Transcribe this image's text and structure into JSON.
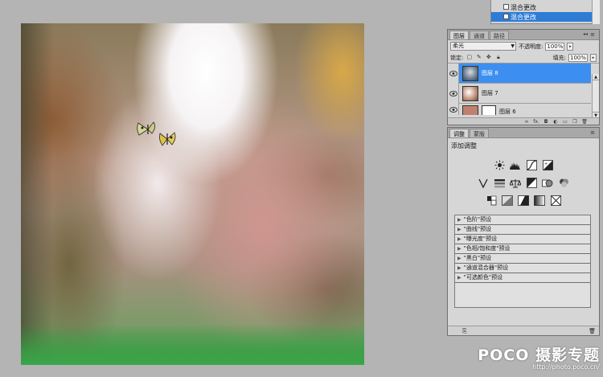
{
  "top_layers": {
    "rows": [
      {
        "label": "混合更改",
        "selected": false
      },
      {
        "label": "混合更改",
        "selected": true
      }
    ]
  },
  "layers_panel": {
    "tabs": [
      "图层",
      "通道",
      "路径"
    ],
    "blend_mode": "柔光",
    "opacity_label": "不透明度:",
    "opacity_value": "100%",
    "lock_label": "锁定:",
    "fill_label": "填充:",
    "fill_value": "100%",
    "layers": [
      {
        "name": "图层 8",
        "selected": true
      },
      {
        "name": "图层 7",
        "selected": false
      },
      {
        "name": "图层 6",
        "selected": false
      }
    ],
    "footer_fx": "fx."
  },
  "adjust_panel": {
    "tabs": [
      "调整",
      "蒙版"
    ],
    "title": "添加调整",
    "presets": [
      "\"色阶\"预设",
      "\"曲线\"预设",
      "\"曝光度\"预设",
      "\"色相/饱和度\"预设",
      "\"黑白\"预设",
      "\"通道混合器\"预设",
      "\"可选颜色\"预设"
    ]
  },
  "watermark": {
    "brand": "POCO 摄影专题",
    "url": "http://photo.poco.cn/"
  },
  "colors": {
    "selection": "#3c8ff0",
    "panel_bg": "#d6d6d6",
    "workspace_bg": "#b4b4b4"
  }
}
